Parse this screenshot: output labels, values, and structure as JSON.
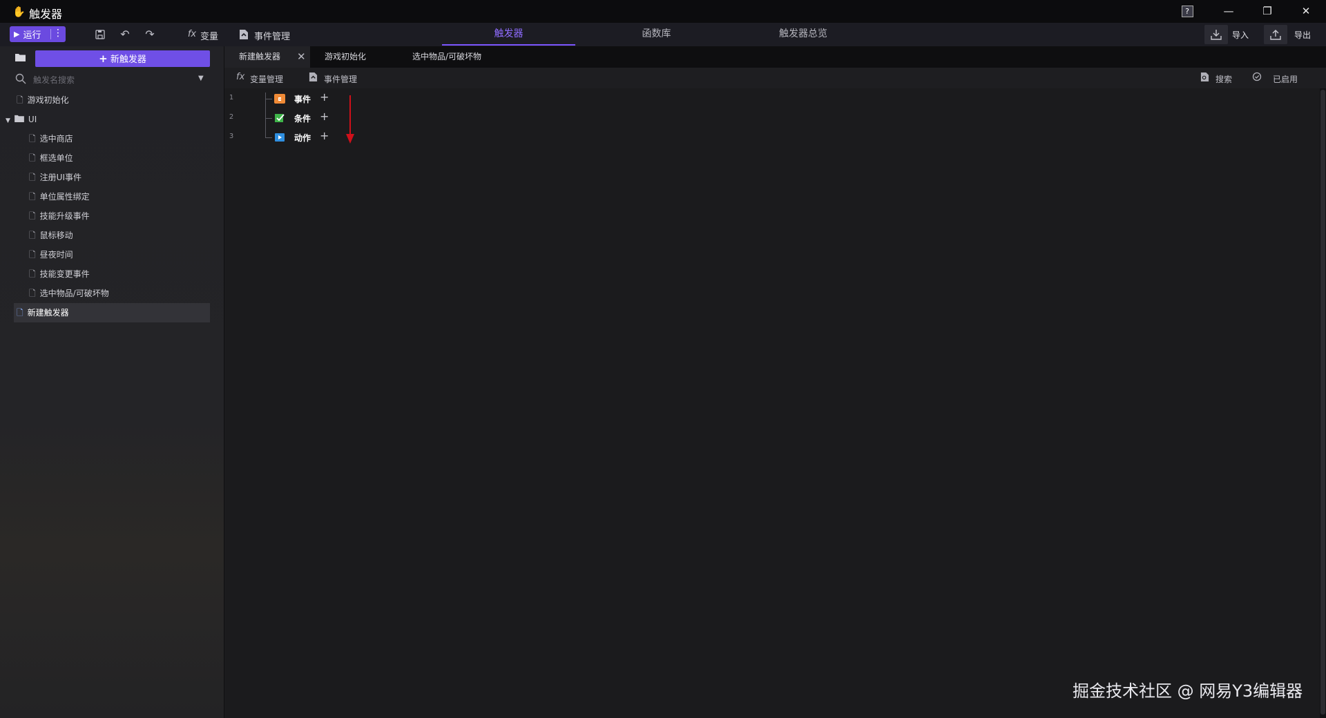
{
  "window": {
    "title": "触发器",
    "controls": {
      "help": "?",
      "minimize": "—",
      "restore": "❐",
      "close": "✕"
    }
  },
  "toolbar": {
    "run_label": "运行",
    "variables_label": "变量",
    "event_manager_label": "事件管理",
    "tabs": [
      "触发器",
      "函数库",
      "触发器总览"
    ],
    "active_tab": "触发器",
    "import_label": "导入",
    "export_label": "导出"
  },
  "sidebar": {
    "new_trigger_label": "新触发器",
    "search_placeholder": "触发名搜索",
    "items": {
      "game_init": "游戏初始化",
      "ui_folder": "UI",
      "ui_children": [
        "选中商店",
        "框选单位",
        "注册UI事件",
        "单位属性绑定",
        "技能升级事件",
        "鼠标移动",
        "昼夜时间",
        "技能变更事件",
        "选中物品/可破坏物"
      ],
      "new_trigger": "新建触发器"
    }
  },
  "editor": {
    "tabs": [
      "新建触发器",
      "游戏初始化",
      "选中物品/可破坏物"
    ],
    "active_tab": "新建触发器",
    "sub_toolbar": {
      "variable_manager": "变量管理",
      "event_manager": "事件管理",
      "search": "搜索",
      "enabled": "已启用"
    },
    "rows": [
      {
        "line": "1",
        "label": "事件",
        "icon": "event-icon",
        "color": "#f08a36"
      },
      {
        "line": "2",
        "label": "条件",
        "icon": "condition-icon",
        "color": "#3fb54a"
      },
      {
        "line": "3",
        "label": "动作",
        "icon": "action-icon",
        "color": "#2f8fe0"
      }
    ]
  },
  "watermark": "掘金技术社区 @ 网易Y3编辑器",
  "colors": {
    "accent": "#7b55ff",
    "annotation_arrow": "#d0101a"
  }
}
